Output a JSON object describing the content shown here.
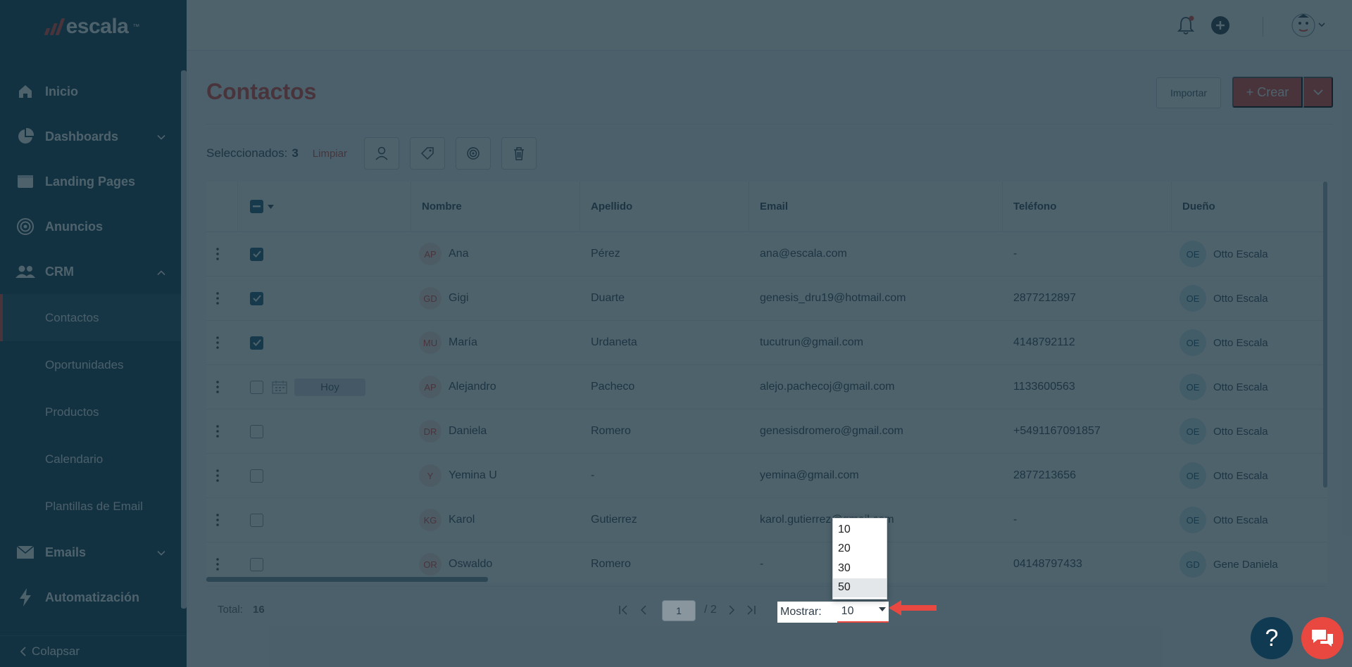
{
  "brand": {
    "name": "escala",
    "tm": "™"
  },
  "sidebar": {
    "items": [
      {
        "label": "Inicio",
        "icon": "home-icon"
      },
      {
        "label": "Dashboards",
        "icon": "pie-chart-icon"
      },
      {
        "label": "Landing Pages",
        "icon": "page-icon"
      },
      {
        "label": "Anuncios",
        "icon": "target-icon"
      },
      {
        "label": "CRM",
        "icon": "users-icon"
      }
    ],
    "crm_sub": [
      "Contactos",
      "Oportunidades",
      "Productos",
      "Calendario",
      "Plantillas de Email"
    ],
    "after": [
      {
        "label": "Emails",
        "icon": "mail-icon"
      },
      {
        "label": "Automatización",
        "icon": "bolt-icon"
      }
    ],
    "collapse_label": "Colapsar"
  },
  "page": {
    "title": "Contactos",
    "import_label": "Importar",
    "create_label": "+ Crear"
  },
  "selection": {
    "label": "Seleccionados:",
    "count": "3",
    "clear_label": "Limpiar"
  },
  "table": {
    "columns": [
      "Nombre",
      "Apellido",
      "Email",
      "Teléfono",
      "Dueño"
    ],
    "rows": [
      {
        "initials": "AP",
        "name": "Ana",
        "last": "Pérez",
        "email": "ana@escala.com",
        "phone": "-",
        "owner_initials": "OE",
        "owner": "Otto Escala",
        "checked": true
      },
      {
        "initials": "GD",
        "name": "Gigi",
        "last": "Duarte",
        "email": "genesis_dru19@hotmail.com",
        "phone": "2877212897",
        "owner_initials": "OE",
        "owner": "Otto Escala",
        "checked": true
      },
      {
        "initials": "MU",
        "name": "María",
        "last": "Urdaneta",
        "email": "tucutrun@gmail.com",
        "phone": "4148792112",
        "owner_initials": "OE",
        "owner": "Otto Escala",
        "checked": true
      },
      {
        "initials": "AP",
        "name": "Alejandro",
        "last": "Pacheco",
        "email": "alejo.pachecoj@gmail.com",
        "phone": "1133600563",
        "owner_initials": "OE",
        "owner": "Otto Escala",
        "checked": false,
        "tag": "Hoy"
      },
      {
        "initials": "DR",
        "name": "Daniela",
        "last": "Romero",
        "email": "genesisdromero@gmail.com",
        "phone": "+5491167091857",
        "owner_initials": "OE",
        "owner": "Otto Escala",
        "checked": false
      },
      {
        "initials": "Y",
        "name": "Yemina U",
        "last": "-",
        "email": "yemina@gmail.com",
        "phone": "2877213656",
        "owner_initials": "OE",
        "owner": "Otto Escala",
        "checked": false
      },
      {
        "initials": "KG",
        "name": "Karol",
        "last": "Gutierrez",
        "email": "karol.gutierrez@gmail.com",
        "phone": "-",
        "owner_initials": "OE",
        "owner": "Otto Escala",
        "checked": false
      },
      {
        "initials": "OR",
        "name": "Oswaldo",
        "last": "Romero",
        "email": "-",
        "phone": "04148797433",
        "owner_initials": "GD",
        "owner": "Gene Daniela",
        "checked": false
      }
    ]
  },
  "footer": {
    "total_label": "Total:",
    "total": "16",
    "page": "1",
    "pages": "/ 2",
    "show_label": "Mostrar:",
    "show_value": "10",
    "options": [
      "10",
      "20",
      "30",
      "50"
    ]
  },
  "colors": {
    "accent": "#e8483f",
    "sidebar": "#0f3a52"
  }
}
